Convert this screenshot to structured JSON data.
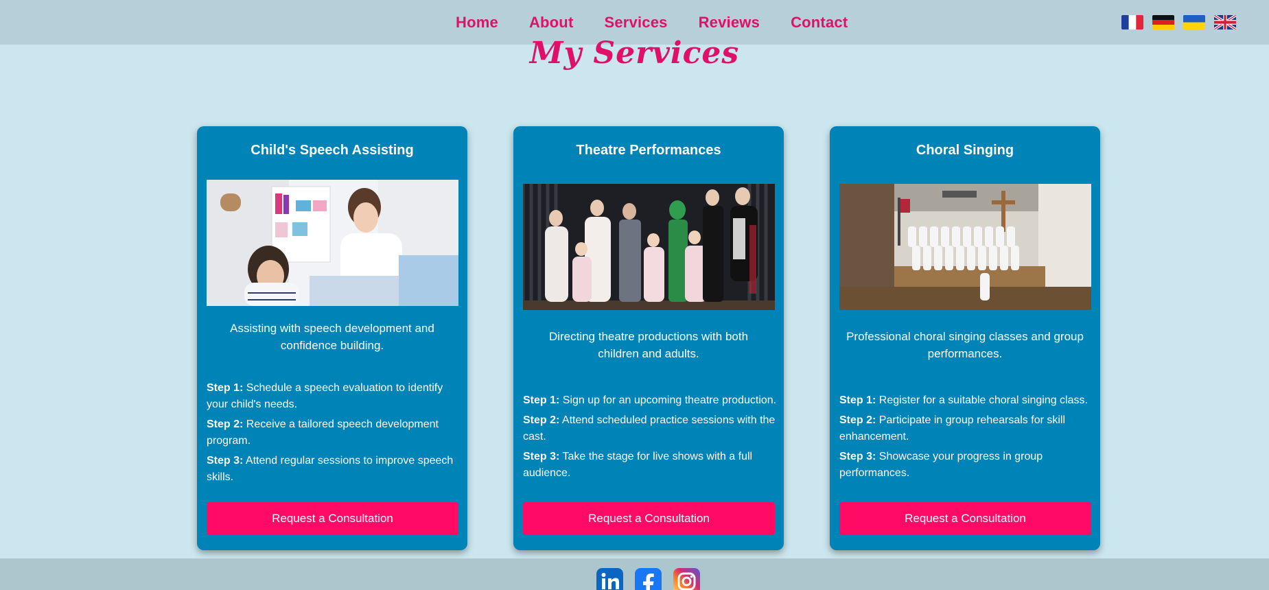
{
  "nav": {
    "items": [
      "Home",
      "About",
      "Services",
      "Reviews",
      "Contact"
    ]
  },
  "flags": [
    "french-flag",
    "german-flag",
    "ukrainian-flag",
    "uk-flag"
  ],
  "page_title": "My Services",
  "cards": [
    {
      "title": "Child's Speech Assisting",
      "description": "Assisting with speech development and confidence building.",
      "steps": [
        {
          "label": "Step 1:",
          "text": "Schedule a speech evaluation to identify your child's needs."
        },
        {
          "label": "Step 2:",
          "text": "Receive a tailored speech development program."
        },
        {
          "label": "Step 3:",
          "text": "Attend regular sessions to improve speech skills."
        }
      ],
      "button": "Request a Consultation"
    },
    {
      "title": "Theatre Performances",
      "description": "Directing theatre productions with both children and adults.",
      "steps": [
        {
          "label": "Step 1:",
          "text": "Sign up for an upcoming theatre production."
        },
        {
          "label": "Step 2:",
          "text": "Attend scheduled practice sessions with the cast."
        },
        {
          "label": "Step 3:",
          "text": "Take the stage for live shows with a full audience."
        }
      ],
      "button": "Request a Consultation"
    },
    {
      "title": "Choral Singing",
      "description": "Professional choral singing classes and group performances.",
      "steps": [
        {
          "label": "Step 1:",
          "text": "Register for a suitable choral singing class."
        },
        {
          "label": "Step 2:",
          "text": "Participate in group rehearsals for skill enhancement."
        },
        {
          "label": "Step 3:",
          "text": "Showcase your progress in group performances."
        }
      ],
      "button": "Request a Consultation"
    }
  ],
  "socials": [
    "linkedin-icon",
    "facebook-icon",
    "instagram-icon"
  ],
  "colors": {
    "accent": "#e0106a",
    "button": "#ff0a65",
    "card": "#0083b6",
    "background": "#cce6ef",
    "navbar": "#b6cfd9"
  }
}
